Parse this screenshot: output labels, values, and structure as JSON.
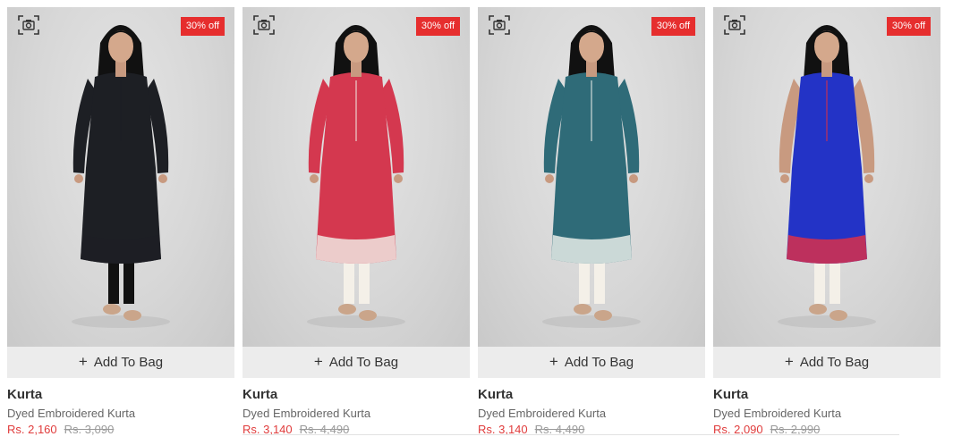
{
  "products": [
    {
      "badge": "30% off",
      "button_label": "Add To Bag",
      "title": "Kurta",
      "subtitle": "Dyed Embroidered Kurta",
      "price": "Rs. 2,160",
      "old_price": "Rs. 3,090",
      "dress_color": "#1d1f24",
      "trim_color": "#1d1f24",
      "pants_color": "#111111"
    },
    {
      "badge": "30% off",
      "button_label": "Add To Bag",
      "title": "Kurta",
      "subtitle": "Dyed Embroidered Kurta",
      "price": "Rs. 3,140",
      "old_price": "Rs. 4,490",
      "dress_color": "#d4384f",
      "trim_color": "#f0e6e0",
      "pants_color": "#f4f0e8"
    },
    {
      "badge": "30% off",
      "button_label": "Add To Bag",
      "title": "Kurta",
      "subtitle": "Dyed Embroidered Kurta",
      "price": "Rs. 3,140",
      "old_price": "Rs. 4,490",
      "dress_color": "#2f6b78",
      "trim_color": "#e6ece8",
      "pants_color": "#f4f0e8"
    },
    {
      "badge": "30% off",
      "button_label": "Add To Bag",
      "title": "Kurta",
      "subtitle": "Dyed Embroidered Kurta",
      "price": "Rs. 2,090",
      "old_price": "Rs. 2,990",
      "dress_color": "#2333c6",
      "trim_color": "#d8304a",
      "pants_color": "#f4f0e8"
    }
  ],
  "icons": {
    "scan": "scan-camera-icon",
    "plus": "plus-icon"
  },
  "colors": {
    "badge": "#e62e2e",
    "price": "#e03c3c",
    "button_bg": "#ececec"
  }
}
